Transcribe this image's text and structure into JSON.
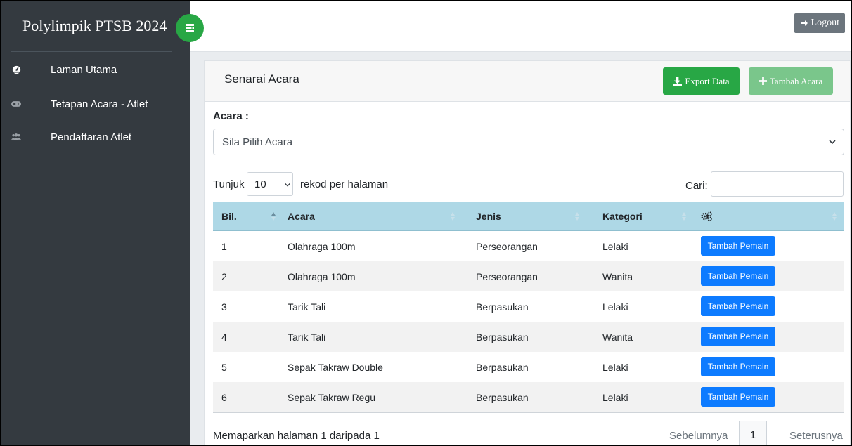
{
  "sidebar": {
    "brand": "Polylimpik PTSB 2024",
    "items": [
      {
        "label": "Laman Utama",
        "icon": "dashboard-icon"
      },
      {
        "label": "Tetapan Acara - Atlet",
        "icon": "gamepad-icon"
      },
      {
        "label": "Pendaftaran Atlet",
        "icon": "users-icon"
      }
    ]
  },
  "topbar": {
    "logout_label": "Logout"
  },
  "card": {
    "title": "Senarai Acara",
    "export_label": "Export Data",
    "add_label": "Tambah Acara"
  },
  "filter": {
    "label": "Acara :",
    "selected": "Sila Pilih Acara"
  },
  "length": {
    "before": "Tunjuk",
    "value": "10",
    "after": "rekod per halaman"
  },
  "search": {
    "label": "Cari:",
    "value": ""
  },
  "table": {
    "headers": [
      "Bil.",
      "Acara",
      "Jenis",
      "Kategori",
      ""
    ],
    "action_label": "Tambah Pemain",
    "rows": [
      {
        "bil": "1",
        "acara": "Olahraga 100m",
        "jenis": "Perseorangan",
        "kategori": "Lelaki"
      },
      {
        "bil": "2",
        "acara": "Olahraga 100m",
        "jenis": "Perseorangan",
        "kategori": "Wanita"
      },
      {
        "bil": "3",
        "acara": "Tarik Tali",
        "jenis": "Berpasukan",
        "kategori": "Lelaki"
      },
      {
        "bil": "4",
        "acara": "Tarik Tali",
        "jenis": "Berpasukan",
        "kategori": "Wanita"
      },
      {
        "bil": "5",
        "acara": "Sepak Takraw Double",
        "jenis": "Berpasukan",
        "kategori": "Lelaki"
      },
      {
        "bil": "6",
        "acara": "Sepak Takraw Regu",
        "jenis": "Berpasukan",
        "kategori": "Lelaki"
      }
    ]
  },
  "footer": {
    "info": "Memaparkan halaman 1 daripada 1",
    "prev": "Sebelumnya",
    "page": "1",
    "next": "Seterusnya"
  },
  "colors": {
    "sidebar": "#343a40",
    "success": "#28a745",
    "primary": "#0d7bff",
    "table_head": "#aed8e6"
  }
}
